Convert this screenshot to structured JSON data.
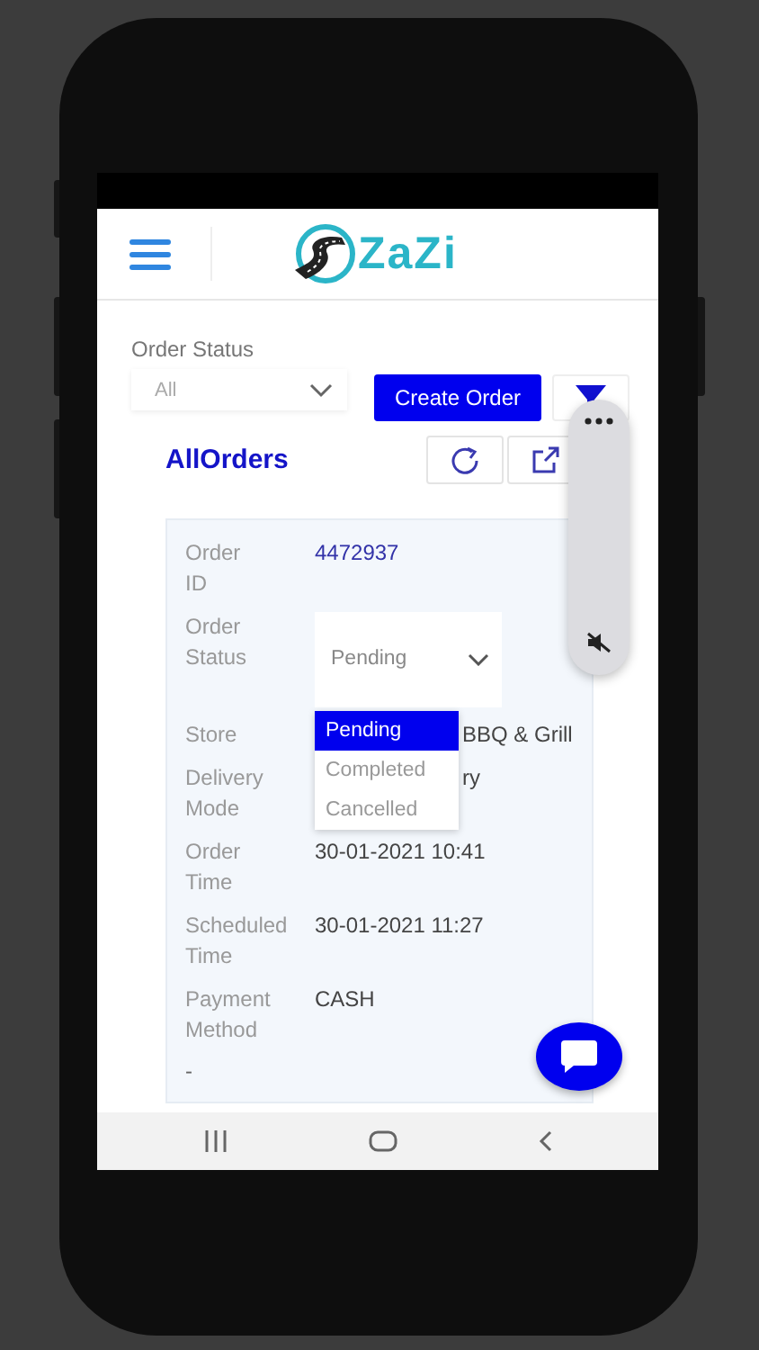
{
  "header": {
    "logo_text": "ZaZi"
  },
  "filter": {
    "label": "Order Status",
    "value": "All"
  },
  "create_button": "Create Order",
  "title": "AllOrders",
  "order": {
    "fields": [
      {
        "label": "Order ID",
        "value": "4472937",
        "kind": "id"
      },
      {
        "label": "Order Status",
        "value": "Pending",
        "kind": "select"
      },
      {
        "label": "Store",
        "value": "BBQ & Grill",
        "kind": "covered"
      },
      {
        "label": "Delivery Mode",
        "value": "ry",
        "kind": "covered"
      },
      {
        "label": "Order Time",
        "value": "30-01-2021 10:41",
        "kind": "text"
      },
      {
        "label": "Scheduled Time",
        "value": "30-01-2021 11:27",
        "kind": "text"
      },
      {
        "label": "Payment Method",
        "value": "CASH",
        "kind": "text"
      }
    ],
    "trailing": "-"
  },
  "status_dropdown": {
    "options": [
      {
        "label": "Pending",
        "selected": true
      },
      {
        "label": "Completed",
        "selected": false
      },
      {
        "label": "Cancelled",
        "selected": false
      }
    ]
  }
}
